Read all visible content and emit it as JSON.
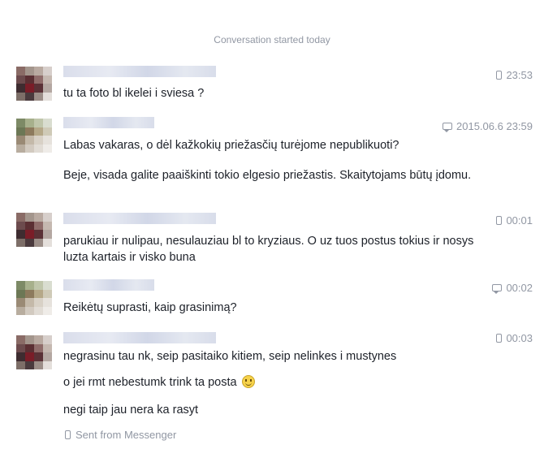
{
  "conversation": {
    "header": "Conversation started today",
    "footer": {
      "sent_label": "Sent from Messenger",
      "icon": "phone-icon"
    }
  },
  "messages": [
    {
      "time": "23:53",
      "source_icon": "phone-icon",
      "lines": [
        "tu ta foto bl ikelei i sviesa ?"
      ]
    },
    {
      "time": "2015.06.6 23:59",
      "source_icon": "chat-icon",
      "lines": [
        "Labas vakaras, o dėl kažkokių priežasčių turėjome nepublikuoti?",
        "Beje, visada galite paaiškinti tokio elgesio priežastis. Skaitytojams būtų įdomu."
      ]
    },
    {
      "time": "00:01",
      "source_icon": "phone-icon",
      "lines": [
        "parukiau ir nulipau, nesulauziau bl to kryziaus. O uz tuos postus tokius ir nosys luzta kartais ir visko buna"
      ]
    },
    {
      "time": "00:02",
      "source_icon": "chat-icon",
      "lines": [
        "Reikėtų suprasti, kaip grasinimą?"
      ]
    },
    {
      "time": "00:03",
      "source_icon": "phone-icon",
      "lines": [
        "negrasinu tau nk, seip pasitaiko kitiem, seip nelinkes i mustynes",
        "o jei rmt nebestumk trink ta posta",
        "negi taip jau nera ka rasyt"
      ]
    }
  ]
}
